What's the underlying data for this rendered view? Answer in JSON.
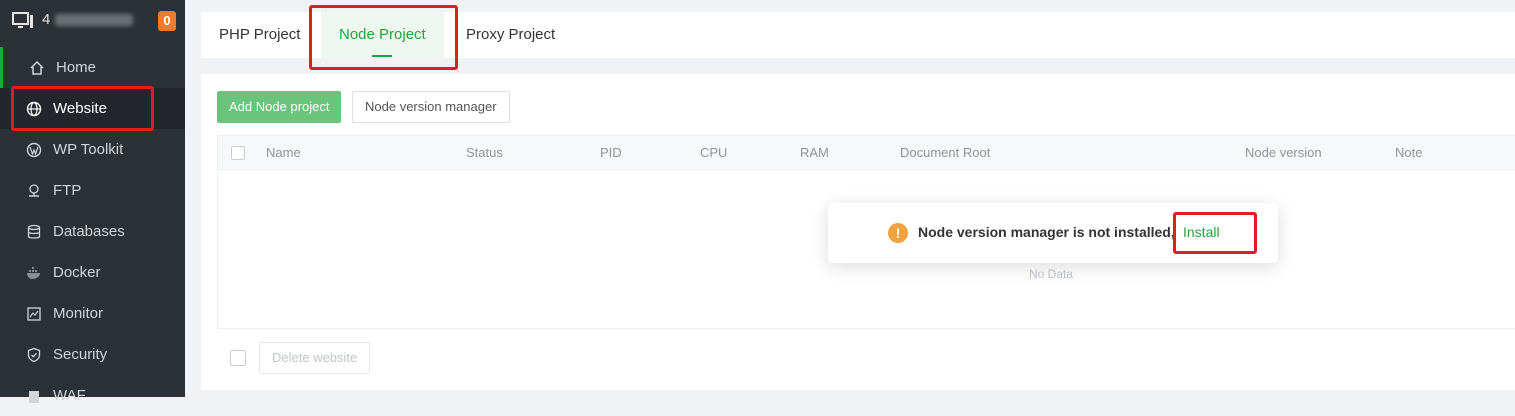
{
  "sidebar": {
    "server_prefix": "4",
    "notification_count": "0",
    "items": [
      {
        "label": "Home",
        "icon": "home-icon"
      },
      {
        "label": "Website",
        "icon": "globe-icon"
      },
      {
        "label": "WP Toolkit",
        "icon": "wordpress-icon"
      },
      {
        "label": "FTP",
        "icon": "ftp-icon"
      },
      {
        "label": "Databases",
        "icon": "database-icon"
      },
      {
        "label": "Docker",
        "icon": "docker-icon"
      },
      {
        "label": "Monitor",
        "icon": "monitor-icon"
      },
      {
        "label": "Security",
        "icon": "shield-icon"
      },
      {
        "label": "WAF",
        "icon": "waf-icon"
      }
    ]
  },
  "tabs": [
    {
      "label": "PHP Project"
    },
    {
      "label": "Node Project",
      "active": true
    },
    {
      "label": "Proxy Project"
    }
  ],
  "toolbar": {
    "add_label": "Add Node project",
    "version_manager_label": "Node version manager"
  },
  "table": {
    "columns": [
      "Name",
      "Status",
      "PID",
      "CPU",
      "RAM",
      "Document Root",
      "Node version",
      "Note"
    ],
    "empty_text": "No Data"
  },
  "footer": {
    "delete_label": "Delete website"
  },
  "toast": {
    "message": "Node version manager is not installed,",
    "action": "Install"
  },
  "colors": {
    "accent": "#20a53a",
    "sidebar_bg": "#2c3138",
    "highlight": "#e51c1c",
    "warning": "#f0a341"
  }
}
